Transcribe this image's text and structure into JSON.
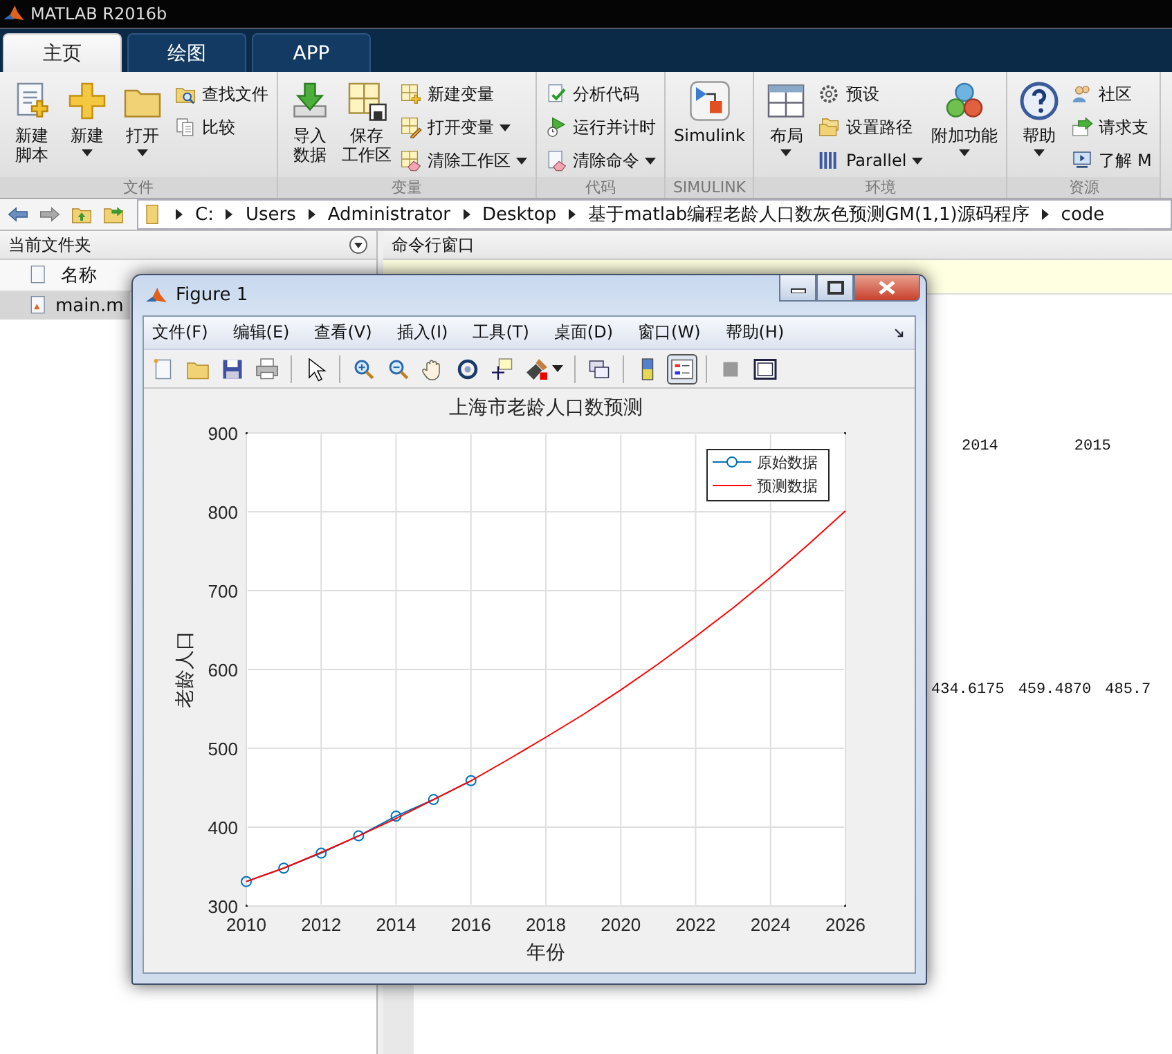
{
  "window": {
    "title": "MATLAB R2016b"
  },
  "tabs": [
    {
      "label": "主页",
      "selected": true
    },
    {
      "label": "绘图",
      "selected": false
    },
    {
      "label": "APP",
      "selected": false
    }
  ],
  "toolstrip": [
    {
      "label": "文件",
      "items": [
        {
          "kind": "large",
          "lines": [
            "新建",
            "脚本"
          ],
          "dropdown": false
        },
        {
          "kind": "large",
          "lines": [
            "新建"
          ],
          "dropdown": true
        },
        {
          "kind": "large",
          "lines": [
            "打开"
          ],
          "dropdown": true
        },
        {
          "kind": "stack",
          "items": [
            {
              "label": "查找文件",
              "dropdown": false
            },
            {
              "label": "比较",
              "dropdown": false
            }
          ]
        }
      ]
    },
    {
      "label": "变量",
      "items": [
        {
          "kind": "large",
          "lines": [
            "导入",
            "数据"
          ],
          "dropdown": false
        },
        {
          "kind": "large",
          "lines": [
            "保存",
            "工作区"
          ],
          "dropdown": false
        },
        {
          "kind": "stack",
          "items": [
            {
              "label": "新建变量",
              "dropdown": false
            },
            {
              "label": "打开变量",
              "dropdown": true
            },
            {
              "label": "清除工作区",
              "dropdown": true
            }
          ]
        }
      ]
    },
    {
      "label": "代码",
      "items": [
        {
          "kind": "stack",
          "items": [
            {
              "label": "分析代码",
              "dropdown": false
            },
            {
              "label": "运行并计时",
              "dropdown": false
            },
            {
              "label": "清除命令",
              "dropdown": true
            }
          ]
        }
      ]
    },
    {
      "label": "SIMULINK",
      "items": [
        {
          "kind": "large",
          "lines": [
            "Simulink"
          ],
          "dropdown": false
        }
      ]
    },
    {
      "label": "环境",
      "items": [
        {
          "kind": "large",
          "lines": [
            "布局"
          ],
          "dropdown": true
        },
        {
          "kind": "stack",
          "items": [
            {
              "label": "预设",
              "dropdown": false
            },
            {
              "label": "设置路径",
              "dropdown": false
            },
            {
              "label": "Parallel",
              "dropdown": true
            }
          ]
        },
        {
          "kind": "large",
          "lines": [
            "附加功能"
          ],
          "dropdown": true
        }
      ]
    },
    {
      "label": "资源",
      "items": [
        {
          "kind": "large",
          "lines": [
            "帮助"
          ],
          "dropdown": true
        },
        {
          "kind": "stack",
          "items": [
            {
              "label": "社区",
              "dropdown": false
            },
            {
              "label": "请求支",
              "dropdown": false
            },
            {
              "label": "了解 M",
              "dropdown": false
            }
          ]
        }
      ]
    }
  ],
  "address": {
    "path": [
      "C:",
      "Users",
      "Administrator",
      "Desktop",
      "基于matlab编程老龄人口数灰色预测GM(1,1)源码程序",
      "code"
    ]
  },
  "current_folder": {
    "title": "当前文件夹",
    "column": "名称",
    "files": [
      {
        "name": "main.m",
        "selected": true
      }
    ]
  },
  "command_window": {
    "title": "命令行窗口",
    "output": [
      [
        "2014",
        "2015"
      ],
      [
        "434.6175",
        "459.4870",
        "485.7"
      ]
    ]
  },
  "figure": {
    "title": "Figure 1",
    "menu": [
      "文件(F)",
      "编辑(E)",
      "查看(V)",
      "插入(I)",
      "工具(T)",
      "桌面(D)",
      "窗口(W)",
      "帮助(H)"
    ],
    "toolbar": [
      {
        "kind": "button",
        "pressed": false,
        "dropdown": false
      },
      {
        "kind": "button",
        "pressed": false,
        "dropdown": false
      },
      {
        "kind": "button",
        "pressed": false,
        "dropdown": false
      },
      {
        "kind": "button",
        "pressed": false,
        "dropdown": false
      },
      {
        "kind": "separator"
      },
      {
        "kind": "button",
        "pressed": false,
        "dropdown": false
      },
      {
        "kind": "separator"
      },
      {
        "kind": "button",
        "pressed": false,
        "dropdown": false
      },
      {
        "kind": "button",
        "pressed": false,
        "dropdown": false
      },
      {
        "kind": "button",
        "pressed": false,
        "dropdown": false
      },
      {
        "kind": "button",
        "pressed": false,
        "dropdown": false
      },
      {
        "kind": "button",
        "pressed": false,
        "dropdown": false
      },
      {
        "kind": "button",
        "pressed": false,
        "dropdown": true
      },
      {
        "kind": "separator"
      },
      {
        "kind": "button",
        "pressed": false,
        "dropdown": false
      },
      {
        "kind": "separator"
      },
      {
        "kind": "button",
        "pressed": false,
        "dropdown": false
      },
      {
        "kind": "button",
        "pressed": true,
        "dropdown": false
      },
      {
        "kind": "separator"
      },
      {
        "kind": "button",
        "pressed": false,
        "dropdown": false
      },
      {
        "kind": "button",
        "pressed": false,
        "dropdown": false
      }
    ],
    "chart_data": {
      "type": "line",
      "title": "上海市老龄人口数预测",
      "xlabel": "年份",
      "ylabel": "老龄人口",
      "x": [
        2010,
        2011,
        2012,
        2013,
        2014,
        2015,
        2016,
        2017,
        2018,
        2019,
        2020,
        2021,
        2022,
        2023,
        2024,
        2025,
        2026
      ],
      "series": [
        {
          "name": "原始数据",
          "color": "#0072bd",
          "marker": "o",
          "values": [
            331,
            348,
            367,
            389,
            414,
            435,
            459,
            null,
            null,
            null,
            null,
            null,
            null,
            null,
            null,
            null,
            null
          ]
        },
        {
          "name": "预测数据",
          "color": "#ff0000",
          "marker": "none",
          "values": [
            331,
            348,
            368,
            389,
            411,
            435,
            459,
            486,
            514,
            543,
            574,
            607,
            642,
            678,
            717,
            758,
            801
          ]
        }
      ],
      "xlim": [
        2010,
        2026
      ],
      "ylim": [
        300,
        900
      ],
      "xticks": [
        2010,
        2012,
        2014,
        2016,
        2018,
        2020,
        2022,
        2024,
        2026
      ],
      "yticks": [
        300,
        400,
        500,
        600,
        700,
        800,
        900
      ],
      "grid": true,
      "legend": true
    }
  }
}
